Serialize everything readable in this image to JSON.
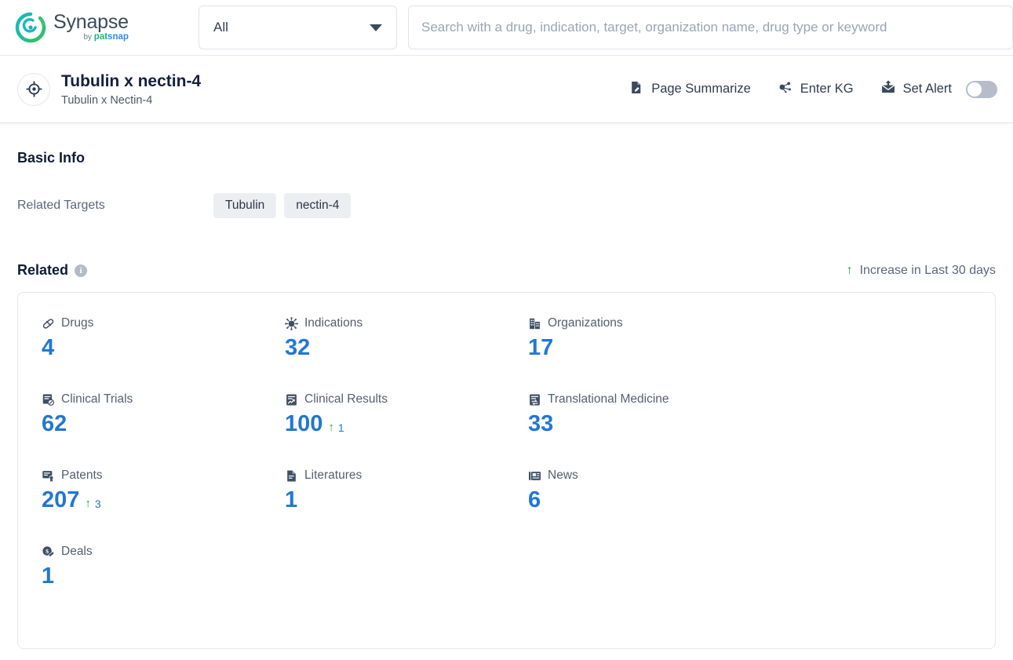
{
  "topbar": {
    "logo_name": "Synapse",
    "logo_by": "by ",
    "logo_pat": "pat",
    "logo_snap": "snap",
    "scope_value": "All",
    "search_placeholder": "Search with a drug, indication, target, organization name, drug type or keyword",
    "search_value": ""
  },
  "titlebar": {
    "title": "Tubulin x nectin-4",
    "subtitle": "Tubulin x Nectin-4",
    "actions": [
      {
        "label": "Page Summarize",
        "icon": "page-summarize-icon"
      },
      {
        "label": "Enter KG",
        "icon": "knowledge-graph-icon"
      },
      {
        "label": "Set Alert",
        "icon": "set-alert-icon"
      }
    ],
    "alert_toggle_on": false
  },
  "basic_info": {
    "heading": "Basic Info",
    "related_targets_label": "Related Targets",
    "related_targets": [
      "Tubulin",
      "nectin-4"
    ]
  },
  "related": {
    "heading": "Related",
    "info_glyph": "i",
    "legend_label": "Increase in Last 30 days",
    "legend_arrow": "↑",
    "accent_color": "#2177d4",
    "increase_color": "#26a93a",
    "stats": [
      {
        "label": "Drugs",
        "icon": "drug-pill-icon",
        "value": "4",
        "delta": null
      },
      {
        "label": "Indications",
        "icon": "virus-icon",
        "value": "32",
        "delta": null
      },
      {
        "label": "Organizations",
        "icon": "building-icon",
        "value": "17",
        "delta": null
      },
      {
        "label": "Clinical Trials",
        "icon": "clinical-trial-icon",
        "value": "62",
        "delta": null
      },
      {
        "label": "Clinical Results",
        "icon": "clinical-results-icon",
        "value": "100",
        "delta": "1"
      },
      {
        "label": "Translational Medicine",
        "icon": "translational-medicine-icon",
        "value": "33",
        "delta": null
      },
      {
        "label": "Patents",
        "icon": "patent-icon",
        "value": "207",
        "delta": "3"
      },
      {
        "label": "Literatures",
        "icon": "literature-icon",
        "value": "1",
        "delta": null
      },
      {
        "label": "News",
        "icon": "news-icon",
        "value": "6",
        "delta": null
      },
      {
        "label": "Deals",
        "icon": "deals-icon",
        "value": "1",
        "delta": null
      }
    ]
  }
}
